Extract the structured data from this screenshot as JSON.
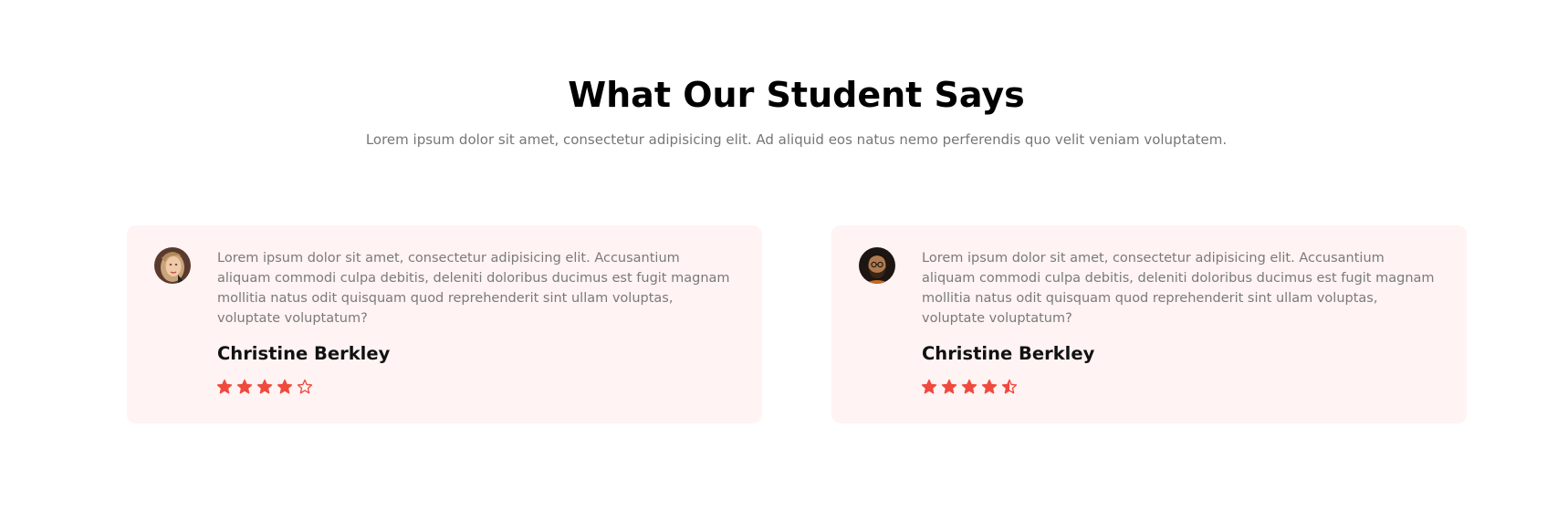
{
  "section": {
    "title": "What Our Student Says",
    "subtitle": "Lorem ipsum dolor sit amet, consectetur adipisicing elit. Ad aliquid eos natus nemo perferendis quo velit veniam voluptatem."
  },
  "colors": {
    "accent": "#f04a3d",
    "card_background": "#fff3f3"
  },
  "testimonials": [
    {
      "text": "Lorem ipsum dolor sit amet, consectetur adipisicing elit. Accusantium aliquam commodi culpa debitis, deleniti doloribus ducimus est fugit magnam mollitia natus odit quisquam quod reprehenderit sint ullam voluptas, voluptate voluptatum?",
      "name": "Christine Berkley",
      "avatar": "woman-avatar",
      "rating": 4,
      "rating_max": 5
    },
    {
      "text": "Lorem ipsum dolor sit amet, consectetur adipisicing elit. Accusantium aliquam commodi culpa debitis, deleniti doloribus ducimus est fugit magnam mollitia natus odit quisquam quod reprehenderit sint ullam voluptas, voluptate voluptatum?",
      "name": "Christine Berkley",
      "avatar": "man-avatar",
      "rating": 4.5,
      "rating_max": 5
    }
  ]
}
